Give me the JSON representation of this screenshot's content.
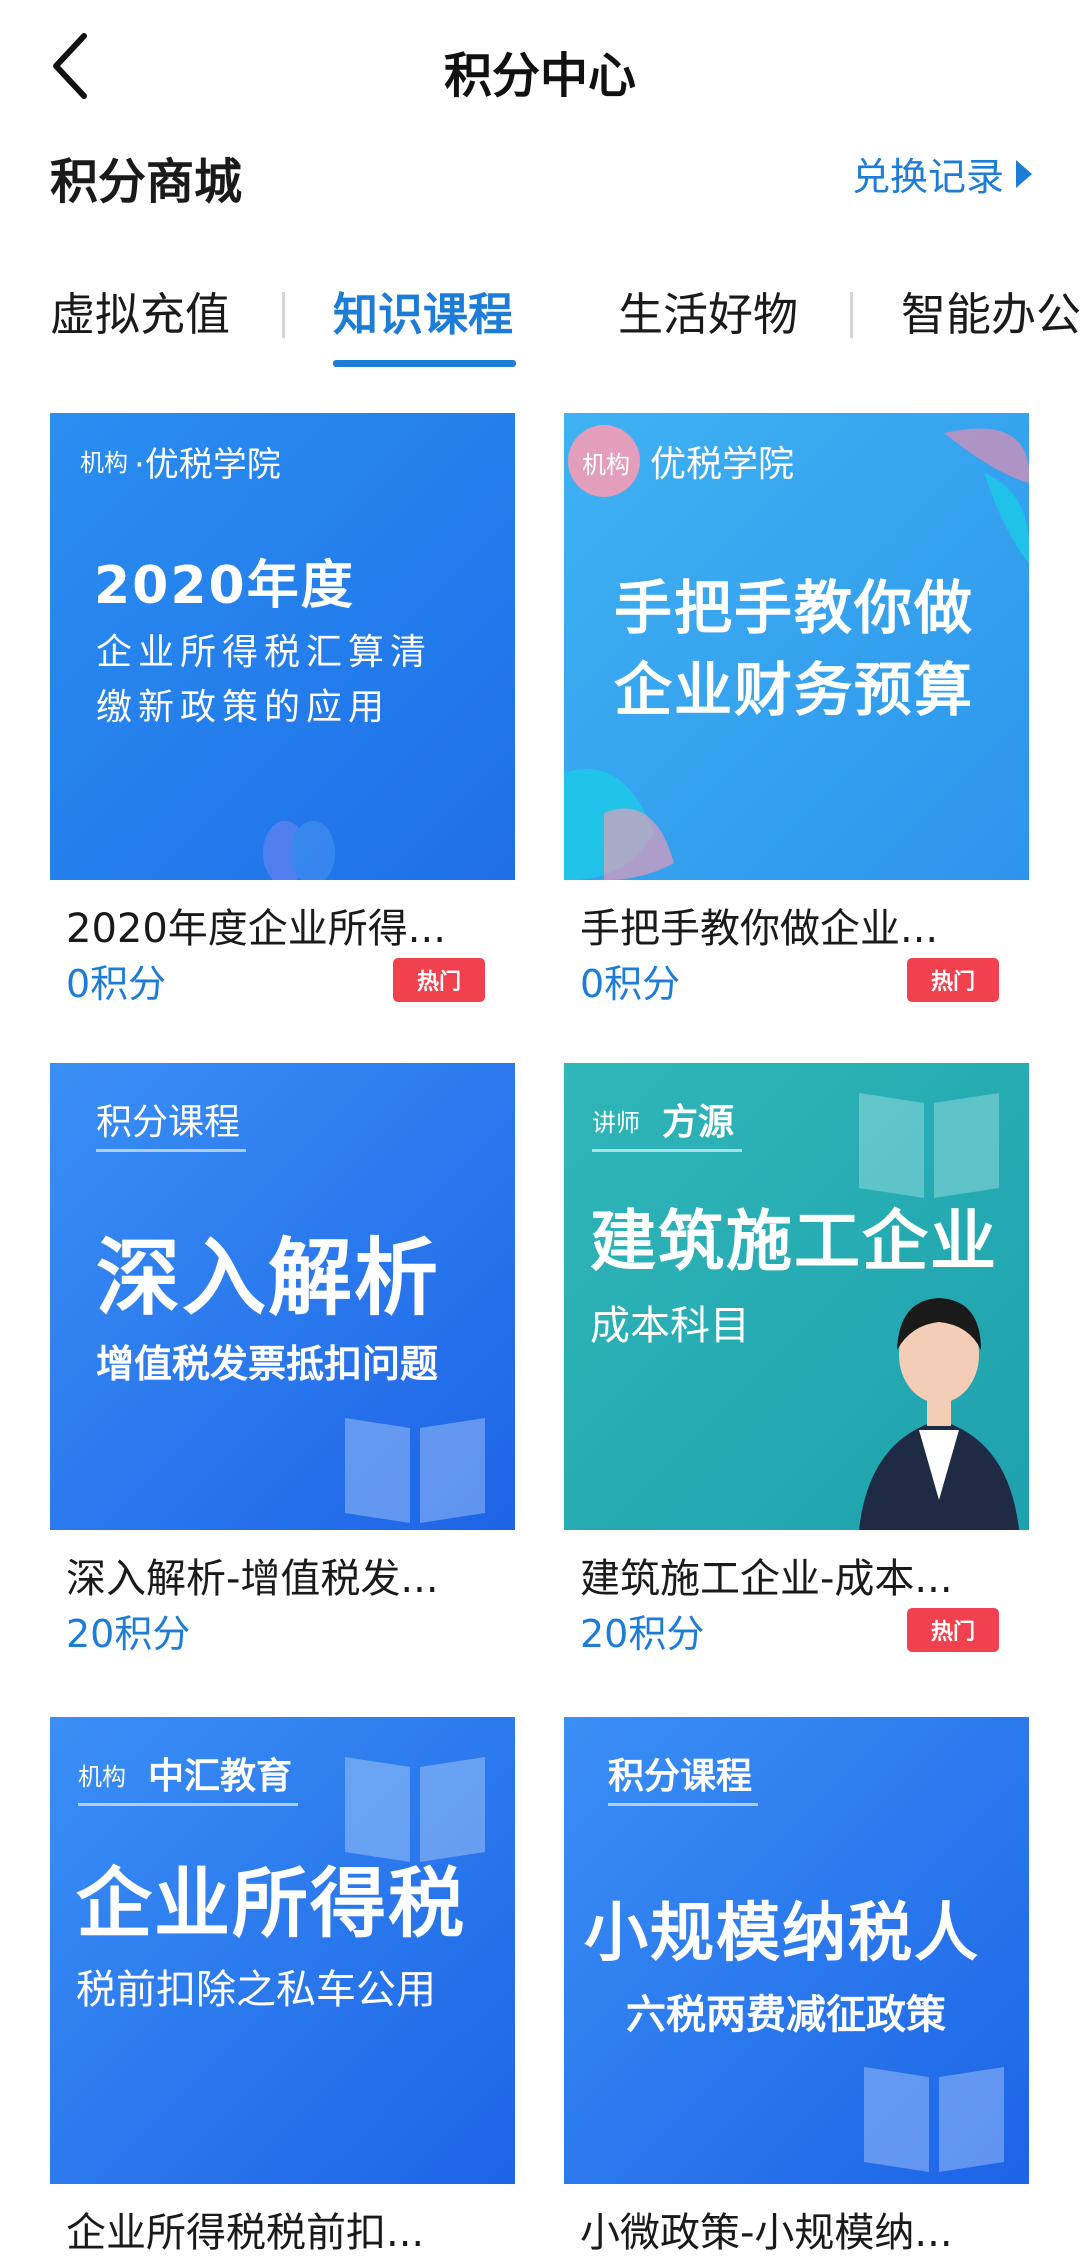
{
  "header": {
    "title": "积分中心"
  },
  "section": {
    "title": "积分商城",
    "redeem_link": "兑换记录"
  },
  "tabs": [
    {
      "label": "虚拟充值",
      "active": false
    },
    {
      "label": "知识课程",
      "active": true
    },
    {
      "label": "生活好物",
      "active": false
    },
    {
      "label": "智能办公",
      "active": false
    }
  ],
  "colors": {
    "accent": "#1c7cd6",
    "hot": "#f1414e"
  },
  "products": [
    {
      "title": "2020年度企业所得...",
      "points": "0积分",
      "badge": "热门",
      "cover": {
        "tag_small": "机构",
        "tag": "·优税学院",
        "big": "2020年度",
        "sub1": "企业所得税汇算清",
        "sub2": "缴新政策的应用"
      }
    },
    {
      "title": "手把手教你做企业...",
      "points": "0积分",
      "badge": "热门",
      "cover": {
        "tag_small": "机构",
        "tag": "优税学院",
        "big1": "手把手教你做",
        "big2": "企业财务预算"
      }
    },
    {
      "title": "深入解析-增值税发...",
      "points": "20积分",
      "badge": "",
      "cover": {
        "tag": "积分课程",
        "big": "深入解析",
        "sub": "增值税发票抵扣问题"
      }
    },
    {
      "title": "建筑施工企业-成本...",
      "points": "20积分",
      "badge": "热门",
      "cover": {
        "tag_small": "讲师",
        "tag": "方源",
        "big": "建筑施工企业",
        "sub": "成本科目"
      }
    },
    {
      "title": "企业所得税税前扣...",
      "points": "",
      "badge": "",
      "cover": {
        "tag_small": "机构",
        "tag": "中汇教育",
        "big": "企业所得税",
        "sub": "税前扣除之私车公用"
      }
    },
    {
      "title": "小微政策-小规模纳...",
      "points": "",
      "badge": "",
      "cover": {
        "tag": "积分课程",
        "big": "小规模纳税人",
        "sub": "六税两费减征政策"
      }
    }
  ]
}
